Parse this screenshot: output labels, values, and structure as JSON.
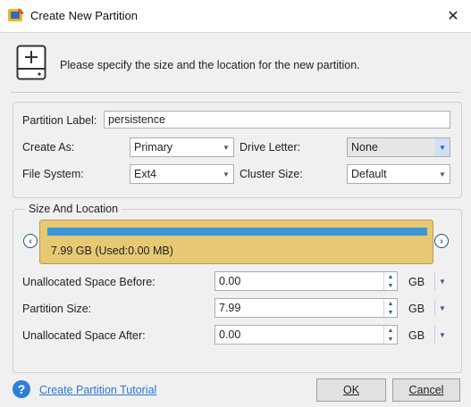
{
  "window": {
    "title": "Create New Partition",
    "close_glyph": "✕"
  },
  "intro_text": "Please specify the size and the location for the new partition.",
  "form": {
    "partition_label_label": "Partition Label:",
    "partition_label_value": "persistence",
    "create_as_label": "Create As:",
    "create_as_value": "Primary",
    "drive_letter_label": "Drive Letter:",
    "drive_letter_value": "None",
    "file_system_label": "File System:",
    "file_system_value": "Ext4",
    "cluster_size_label": "Cluster Size:",
    "cluster_size_value": "Default"
  },
  "size_location": {
    "group_title": "Size And Location",
    "map_caption": "7.99 GB (Used:0.00 MB)",
    "unalloc_before_label": "Unallocated Space Before:",
    "unalloc_before_value": "0.00",
    "partition_size_label": "Partition Size:",
    "partition_size_value": "7.99",
    "unalloc_after_label": "Unallocated Space After:",
    "unalloc_after_value": "0.00",
    "unit": "GB"
  },
  "footer": {
    "help_glyph": "?",
    "tutorial_link": "Create Partition Tutorial",
    "ok_label": "OK",
    "cancel_label": "Cancel"
  },
  "colors": {
    "map_fill": "#e7c873",
    "map_bar": "#3c96d8",
    "link": "#2b78cf"
  }
}
